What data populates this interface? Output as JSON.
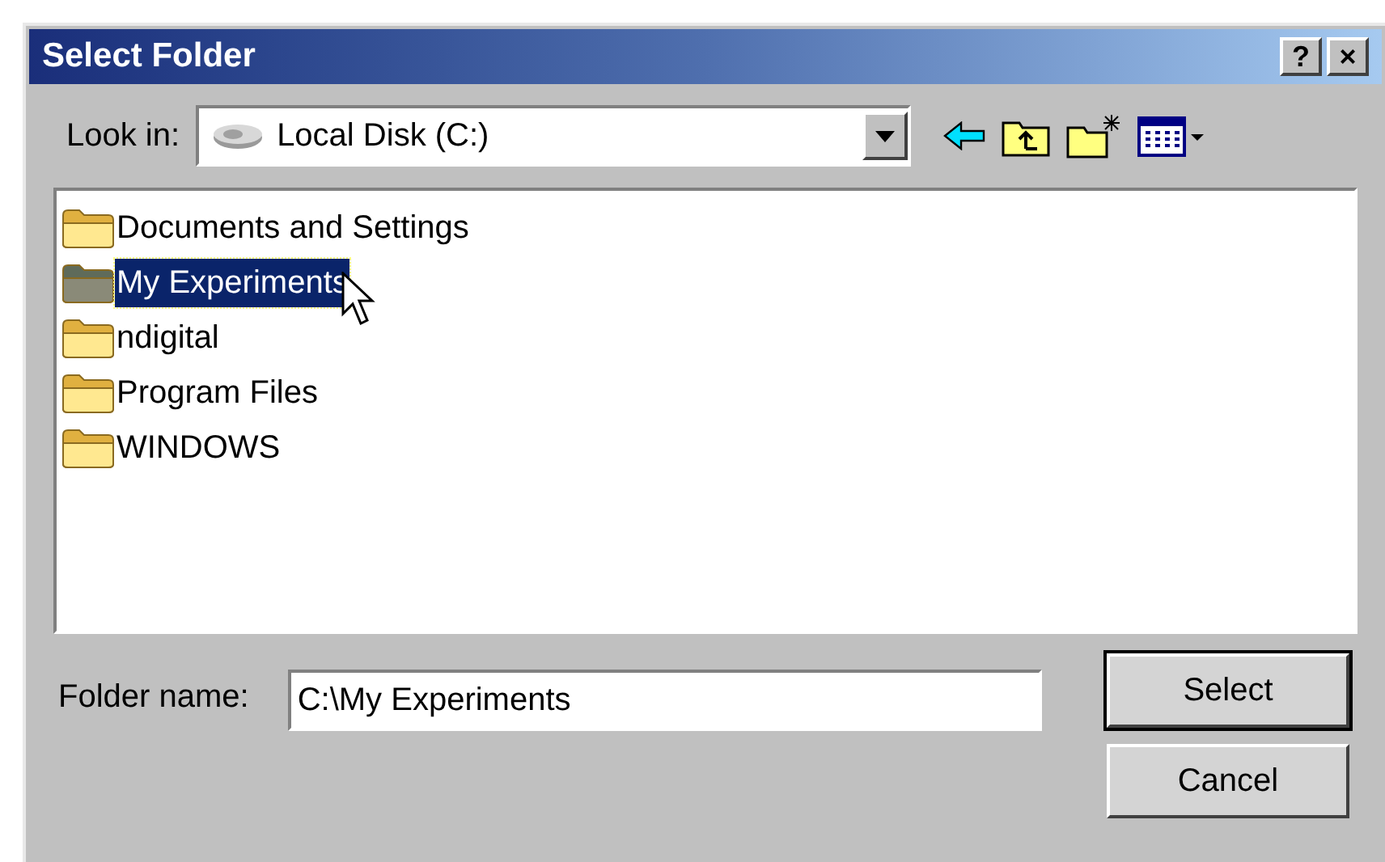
{
  "window": {
    "title": "Select Folder",
    "title_buttons": [
      "?",
      "×"
    ]
  },
  "look_in": {
    "label": "Look in:",
    "value": "Local Disk (C:)"
  },
  "folders": [
    {
      "name": "Documents and Settings",
      "selected": false
    },
    {
      "name": "My Experiments",
      "selected": true
    },
    {
      "name": "ndigital",
      "selected": false
    },
    {
      "name": "Program Files",
      "selected": false
    },
    {
      "name": "WINDOWS",
      "selected": false
    }
  ],
  "folder_name": {
    "label": "Folder name:",
    "value": "C:\\My Experiments"
  },
  "buttons": [
    {
      "label": "Select",
      "default": true
    },
    {
      "label": "Cancel",
      "default": false
    }
  ]
}
